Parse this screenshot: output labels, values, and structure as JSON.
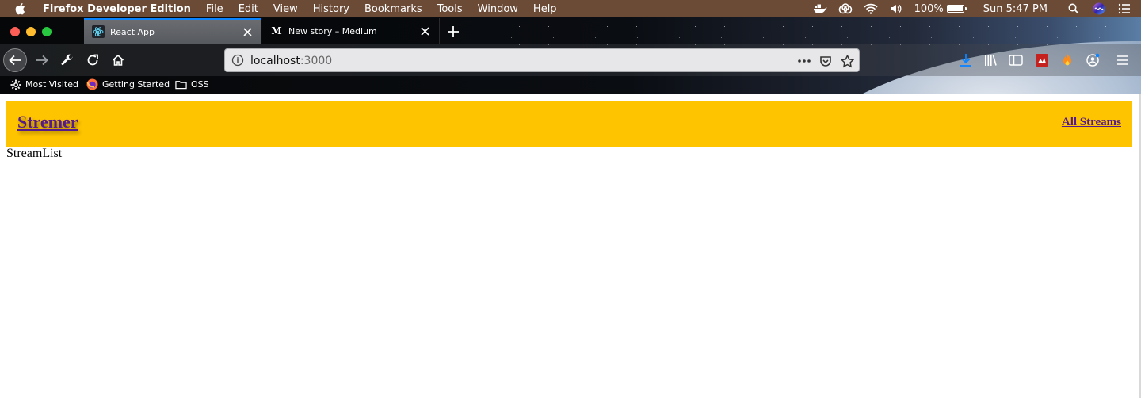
{
  "menubar": {
    "app_name": "Firefox Developer Edition",
    "menus": [
      "File",
      "Edit",
      "View",
      "History",
      "Bookmarks",
      "Tools",
      "Window",
      "Help"
    ],
    "battery": "100%",
    "clock": "Sun 5:47 PM"
  },
  "tabs": [
    {
      "title": "React App",
      "active": true,
      "icon": "react-icon"
    },
    {
      "title": "New story – Medium",
      "active": false,
      "icon": "medium-icon"
    }
  ],
  "urlbar": {
    "host": "localhost",
    "port": ":3000"
  },
  "bookmarks": [
    {
      "label": "Most Visited",
      "icon": "gear-icon"
    },
    {
      "label": "Getting Started",
      "icon": "firefox-icon"
    },
    {
      "label": "OSS",
      "icon": "folder-icon"
    }
  ],
  "page": {
    "brand": "Stremer",
    "nav_link": "All Streams",
    "content": "StreamList"
  },
  "colors": {
    "menubar": "#6b4a36",
    "header": "#ffc400",
    "link": "#551a8b"
  }
}
